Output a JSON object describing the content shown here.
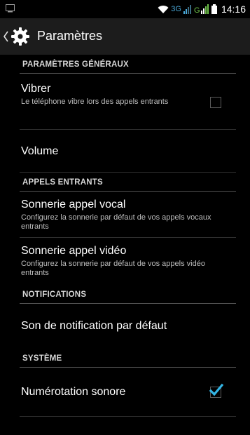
{
  "statusbar": {
    "network": "3G",
    "time": "14:16"
  },
  "actionbar": {
    "title": "Paramètres"
  },
  "sections": {
    "general": "PARAMÈTRES GÉNÉRAUX",
    "incoming": "APPELS ENTRANTS",
    "notifications": "NOTIFICATIONS",
    "system": "SYSTÈME"
  },
  "items": {
    "vibrate": {
      "title": "Vibrer",
      "summary": "Le téléphone vibre lors des appels entrants",
      "checked": false
    },
    "volume": {
      "title": "Volume"
    },
    "voice_ringtone": {
      "title": "Sonnerie appel vocal",
      "summary": "Configurez la sonnerie par défaut de vos appels vocaux entrants"
    },
    "video_ringtone": {
      "title": "Sonnerie appel vidéo",
      "summary": "Configurez la sonnerie par défaut de vos appels vidéo entrants"
    },
    "notification_sound": {
      "title": "Son de notification par défaut"
    },
    "dial_tones": {
      "title": "Numérotation sonore",
      "checked": true
    }
  },
  "colors": {
    "accent": "#33b5e5",
    "background": "#000000",
    "actionbar": "#1c1c1c"
  }
}
